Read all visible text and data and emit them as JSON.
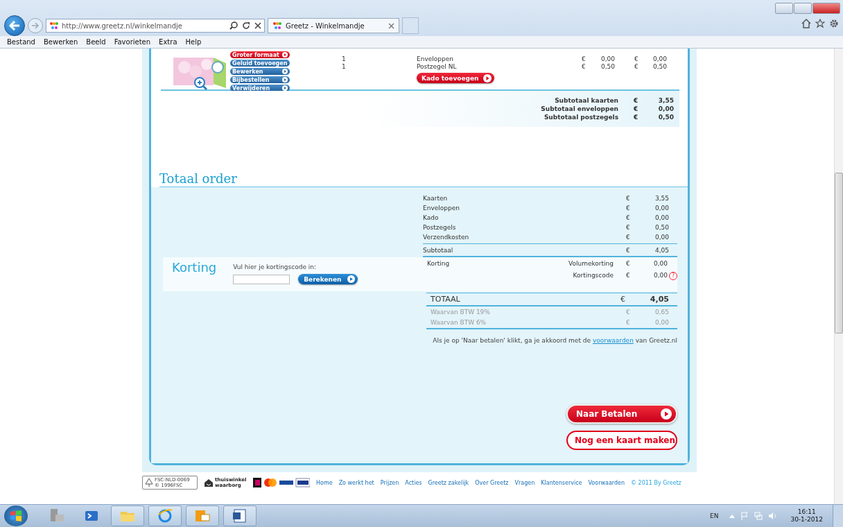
{
  "browser": {
    "url": "http://www.greetz.nl/winkelmandje",
    "tab_title": "Greetz - Winkelmandje",
    "menu": [
      "Bestand",
      "Bewerken",
      "Beeld",
      "Favorieten",
      "Extra",
      "Help"
    ]
  },
  "cart_item": {
    "actions": [
      {
        "label": "Groter formaat",
        "kind": "red"
      },
      {
        "label": "Geluid toevoegen",
        "kind": "blue"
      },
      {
        "label": "Bewerken",
        "kind": "blue"
      },
      {
        "label": "Bijbestellen",
        "kind": "blue"
      },
      {
        "label": "Verwijderen",
        "kind": "blue"
      }
    ],
    "lines": [
      {
        "quantity": "1",
        "product": "Enveloppen",
        "cur1": "€",
        "price": "0,00",
        "cur2": "€",
        "total": "0,00"
      },
      {
        "quantity": "1",
        "product": "Postzegel NL",
        "cur1": "€",
        "price": "0,50",
        "cur2": "€",
        "total": "0,50"
      }
    ],
    "kado_button": "Kado toevoegen"
  },
  "subtotals": [
    {
      "label": "Subtotaal kaarten",
      "currency": "€",
      "amount": "3,55"
    },
    {
      "label": "Subtotaal enveloppen",
      "currency": "€",
      "amount": "0,00"
    },
    {
      "label": "Subtotaal postzegels",
      "currency": "€",
      "amount": "0,50"
    }
  ],
  "total_order": {
    "title": "Totaal order",
    "lines": [
      {
        "label": "Kaarten",
        "currency": "€",
        "amount": "3,55"
      },
      {
        "label": "Enveloppen",
        "currency": "€",
        "amount": "0,00"
      },
      {
        "label": "Kado",
        "currency": "€",
        "amount": "0,00"
      },
      {
        "label": "Postzegels",
        "currency": "€",
        "amount": "0,50"
      },
      {
        "label": "Verzendkosten",
        "currency": "€",
        "amount": "0,00"
      }
    ],
    "subtotal": {
      "label": "Subtotaal",
      "currency": "€",
      "amount": "4,05"
    },
    "korting": {
      "title": "Korting",
      "prompt": "Vul hier je kortingscode in:",
      "button": "Berekenen",
      "label": "Korting",
      "help_mark": "?",
      "rows": [
        {
          "label": "Volumekorting",
          "currency": "€",
          "amount": "0,00",
          "help": false
        },
        {
          "label": "Kortingscode",
          "currency": "€",
          "amount": "0,00",
          "help": true
        }
      ]
    },
    "total": {
      "label": "TOTAAL",
      "currency": "€",
      "amount": "4,05"
    },
    "vat": [
      {
        "label": "Waarvan BTW 19%",
        "currency": "€",
        "amount": "0,65"
      },
      {
        "label": "Waarvan BTW 6%",
        "currency": "€",
        "amount": "0,00"
      }
    ],
    "terms": {
      "before": "Als je op 'Naar betalen' klikt, ga je akkoord met de",
      "link": "voorwaarden",
      "after": "van Greetz.nl"
    },
    "buttons": [
      {
        "label": "Naar Betalen",
        "kind": "primary"
      },
      {
        "label": "Nog een kaart maken",
        "kind": "secondary"
      }
    ]
  },
  "footer": {
    "links": [
      "Home",
      "Zo werkt het",
      "Prijzen",
      "Acties",
      "Greetz zakelijk",
      "Over Greetz",
      "Vragen",
      "Klantenservice",
      "Voorwaarden"
    ],
    "copyright": "© 2011 By Greetz",
    "fsc_text": "FSC-NLD-0069 © 1996FSC",
    "thuiswinkel": "thuiswinkel waarborg"
  },
  "taskbar": {
    "language": "EN",
    "time": "16:11",
    "date": "30-1-2012"
  }
}
